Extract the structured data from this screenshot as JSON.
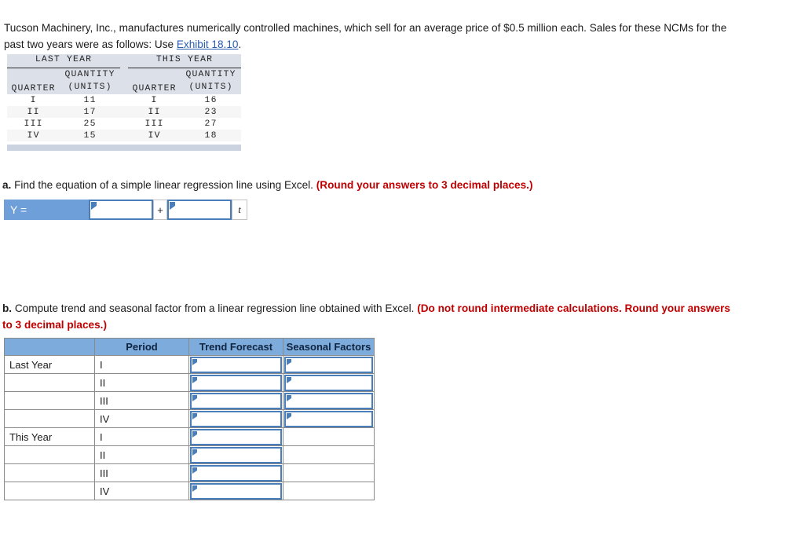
{
  "intro": {
    "text_before_link": "Tucson Machinery, Inc., manufactures numerically controlled machines, which sell for an average price of $0.5 million each. Sales for these NCMs for the past two years were as follows: Use ",
    "link_label": "Exhibit 18.10",
    "text_after_link": "."
  },
  "sales_table": {
    "group_headers": [
      "LAST YEAR",
      "THIS YEAR"
    ],
    "column_headers": {
      "quarter": "QUARTER",
      "quantity_line1": "QUANTITY",
      "quantity_line2": "(UNITS)"
    },
    "rows": [
      {
        "last_quarter": "I",
        "last_quantity": "11",
        "this_quarter": "I",
        "this_quantity": "16"
      },
      {
        "last_quarter": "II",
        "last_quantity": "17",
        "this_quarter": "II",
        "this_quantity": "23"
      },
      {
        "last_quarter": "III",
        "last_quantity": "25",
        "this_quarter": "III",
        "this_quantity": "27"
      },
      {
        "last_quarter": "IV",
        "last_quantity": "15",
        "this_quarter": "IV",
        "this_quantity": "18"
      }
    ]
  },
  "question_a": {
    "label": "a.",
    "text": " Find the equation of a simple linear regression line using Excel. ",
    "note": "(Round your answers to 3 decimal places.)"
  },
  "equation": {
    "y_label": "Y =",
    "intercept_value": "",
    "plus_label": "+",
    "slope_value": "",
    "t_label": "t"
  },
  "question_b": {
    "label": "b.",
    "text": " Compute trend and seasonal factor from a linear regression line obtained with Excel. ",
    "note": "(Do not round intermediate calculations. Round your answers to 3 decimal places.)"
  },
  "trend_table": {
    "headers": {
      "year": "",
      "period": "Period",
      "trend_forecast": "Trend Forecast",
      "seasonal_factors": "Seasonal Factors"
    },
    "rows": [
      {
        "year": "Last Year",
        "period": "I",
        "trend_value": "",
        "seasonal_value": "",
        "has_seasonal": true
      },
      {
        "year": "",
        "period": "II",
        "trend_value": "",
        "seasonal_value": "",
        "has_seasonal": true
      },
      {
        "year": "",
        "period": "III",
        "trend_value": "",
        "seasonal_value": "",
        "has_seasonal": true
      },
      {
        "year": "",
        "period": "IV",
        "trend_value": "",
        "seasonal_value": "",
        "has_seasonal": true
      },
      {
        "year": "This Year",
        "period": "I",
        "trend_value": "",
        "seasonal_value": "",
        "has_seasonal": false
      },
      {
        "year": "",
        "period": "II",
        "trend_value": "",
        "seasonal_value": "",
        "has_seasonal": false
      },
      {
        "year": "",
        "period": "III",
        "trend_value": "",
        "seasonal_value": "",
        "has_seasonal": false
      },
      {
        "year": "",
        "period": "IV",
        "trend_value": "",
        "seasonal_value": "",
        "has_seasonal": false
      }
    ]
  },
  "colors": {
    "link": "#2a5db0",
    "note_red": "#c00000",
    "header_blue": "#7cabdc",
    "input_border_blue": "#4a7ebb",
    "y_label_blue": "#6f9fd8",
    "sales_header_bg": "#dce0e8"
  }
}
